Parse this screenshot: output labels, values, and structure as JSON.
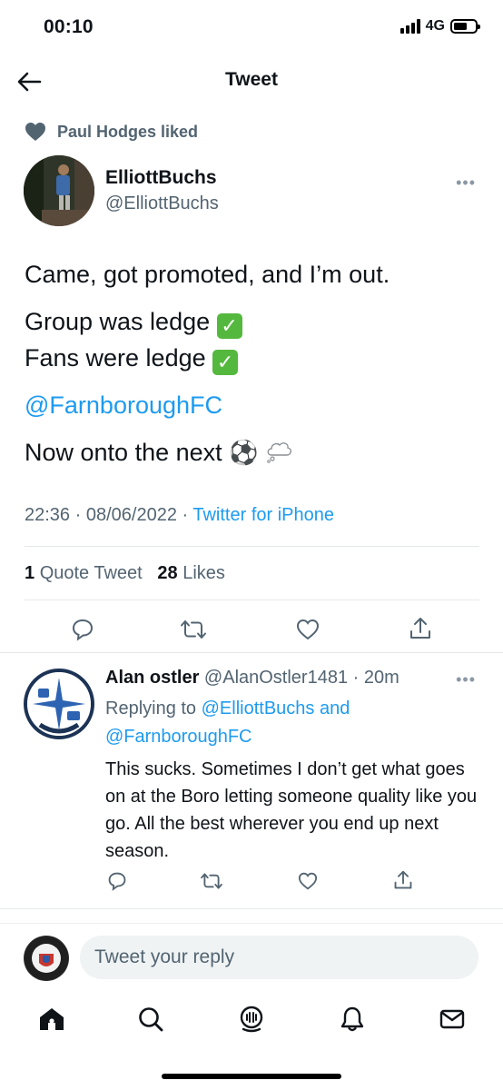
{
  "status": {
    "time": "00:10",
    "network": "4G"
  },
  "nav": {
    "title": "Tweet"
  },
  "social_context": {
    "text": "Paul Hodges liked"
  },
  "tweet": {
    "author_name": "ElliottBuchs",
    "author_handle": "@ElliottBuchs",
    "line1": "Came, got promoted, and I’m out.",
    "line2": "Group was ledge",
    "line3": "Fans were ledge",
    "mention": "@FarnboroughFC",
    "line4": "Now onto the next",
    "time": "22:36",
    "date": "08/06/2022",
    "source": "Twitter for iPhone",
    "quote_count": "1",
    "quote_label": "Quote Tweet",
    "likes_count": "28",
    "likes_label": "Likes"
  },
  "reply": {
    "name": "Alan ostler",
    "handle": "@AlanOstler1481",
    "age": "20m",
    "replying_label": "Replying to",
    "replying_to_1": "@ElliottBuchs",
    "replying_and": "and",
    "replying_to_2": "@FarnboroughFC",
    "text": "This sucks. Sometimes I don’t get what goes on at the Boro letting someone quality like you go. All the best wherever you end up next season."
  },
  "composer": {
    "placeholder": "Tweet your reply"
  },
  "tabs": [
    "home-icon",
    "search-icon",
    "spaces-icon",
    "notifications-icon",
    "messages-icon"
  ],
  "colors": {
    "accent": "#1d9bf0",
    "secondary_text": "#536471",
    "check_green": "#55b83e"
  }
}
